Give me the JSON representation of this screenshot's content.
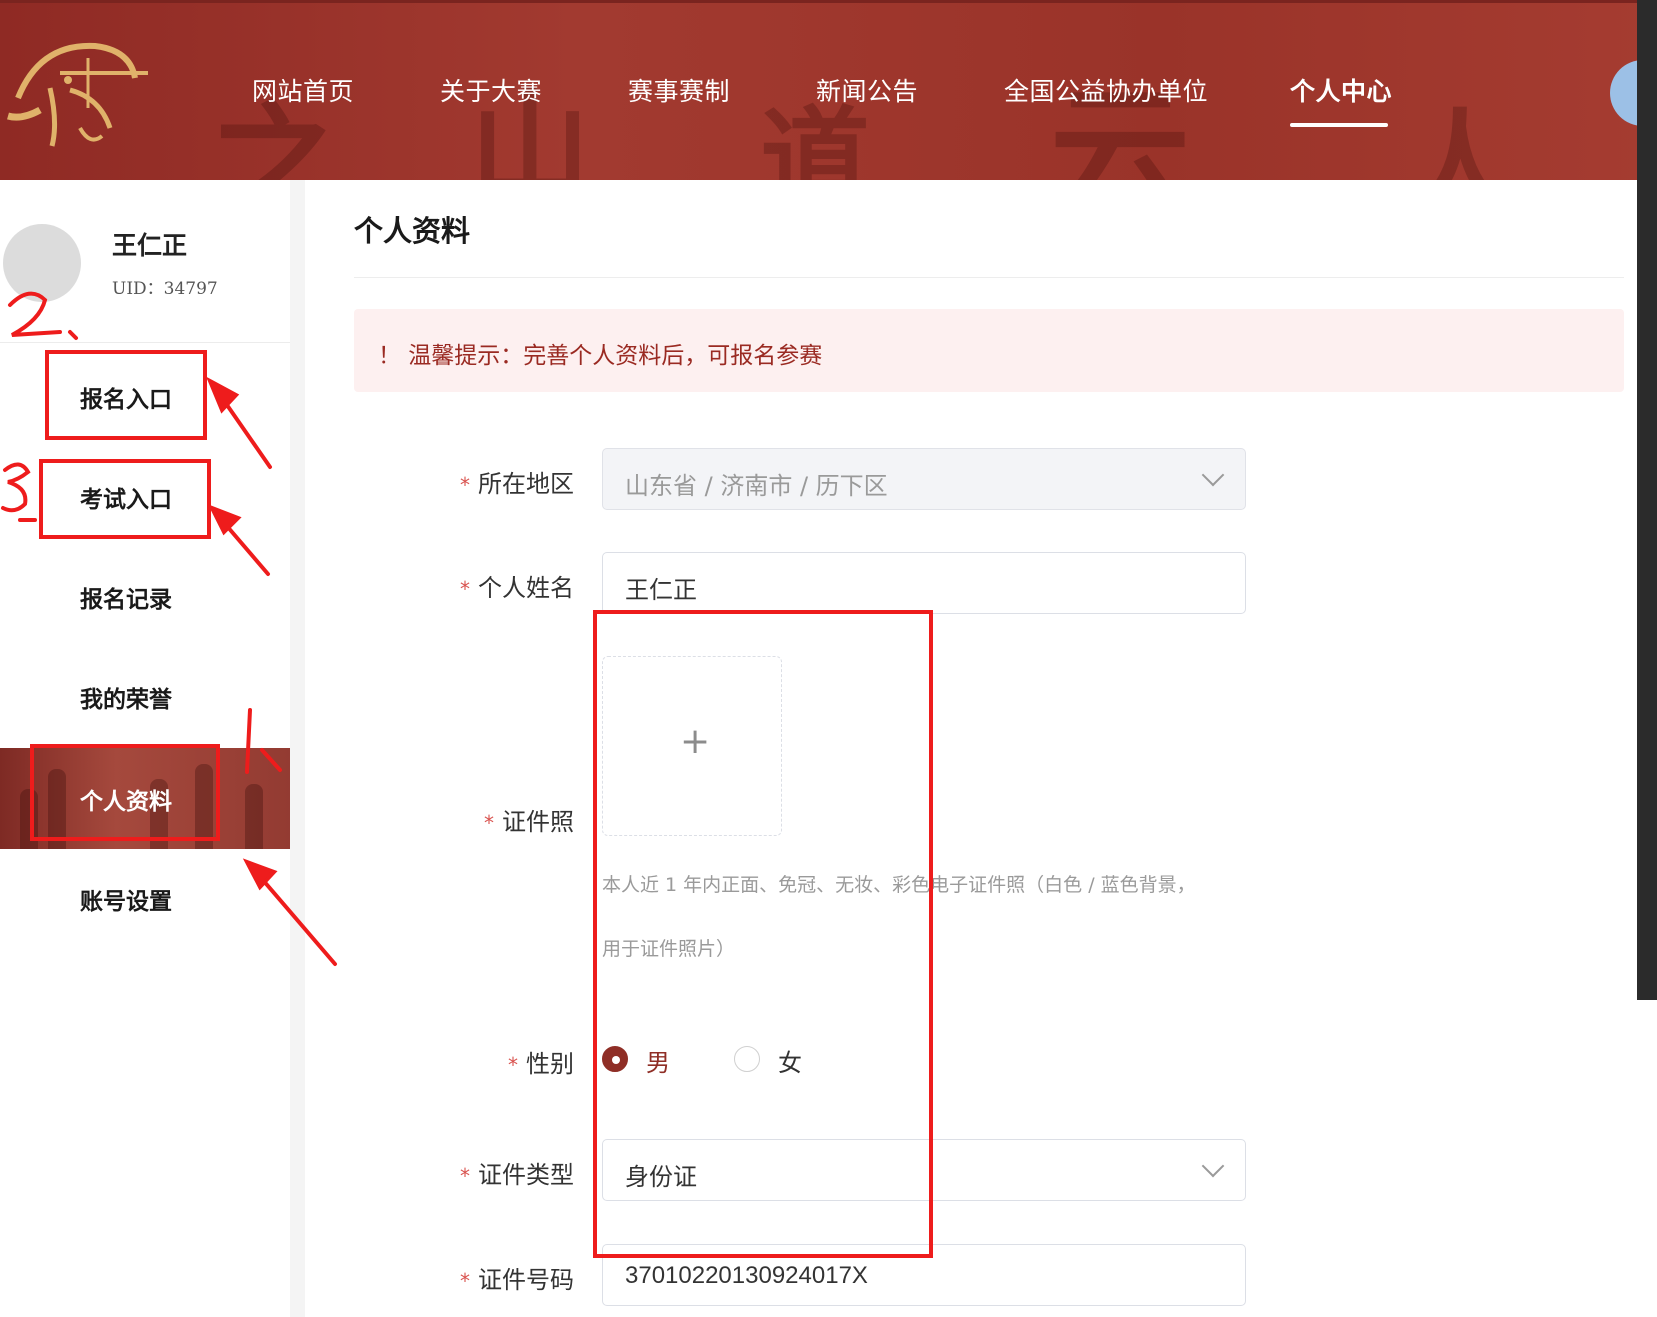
{
  "nav": {
    "items": [
      {
        "label": "网站首页"
      },
      {
        "label": "关于大赛"
      },
      {
        "label": "赛事赛制"
      },
      {
        "label": "新闻公告"
      },
      {
        "label": "全国公益协办单位"
      },
      {
        "label": "个人中心",
        "active": true
      }
    ]
  },
  "user": {
    "name": "王仁正",
    "uid": "UID：34797"
  },
  "sidebar": {
    "items": [
      {
        "label": "报名入口"
      },
      {
        "label": "考试入口"
      },
      {
        "label": "报名记录"
      },
      {
        "label": "我的荣誉"
      },
      {
        "label": "个人资料",
        "active": true
      },
      {
        "label": "账号设置"
      }
    ]
  },
  "main": {
    "title": "个人资料",
    "notice": "！ 温馨提示：完善个人资料后，可报名参赛"
  },
  "form": {
    "region": {
      "label": "所在地区",
      "value": "山东省 / 济南市 / 历下区"
    },
    "name": {
      "label": "个人姓名",
      "value": "王仁正"
    },
    "photo": {
      "label": "证件照",
      "hint_line1": "本人近 1 年内正面、免冠、无妆、彩色电子证件照（白色 / 蓝色背景，",
      "hint_line2": "用于证件照片）"
    },
    "gender": {
      "label": "性别",
      "options": [
        "男",
        "女"
      ],
      "selected": "男"
    },
    "id_type": {
      "label": "证件类型",
      "value": "身份证"
    },
    "id_number": {
      "label": "证件号码",
      "value": "37010220130924017X"
    }
  },
  "annotations": {
    "mark_1": "1、",
    "mark_2": "2、",
    "mark_3": "3"
  },
  "colors": {
    "brand": "#9a3329",
    "notice_bg": "#fdf0f0",
    "annotation": "#ee1c1c"
  }
}
